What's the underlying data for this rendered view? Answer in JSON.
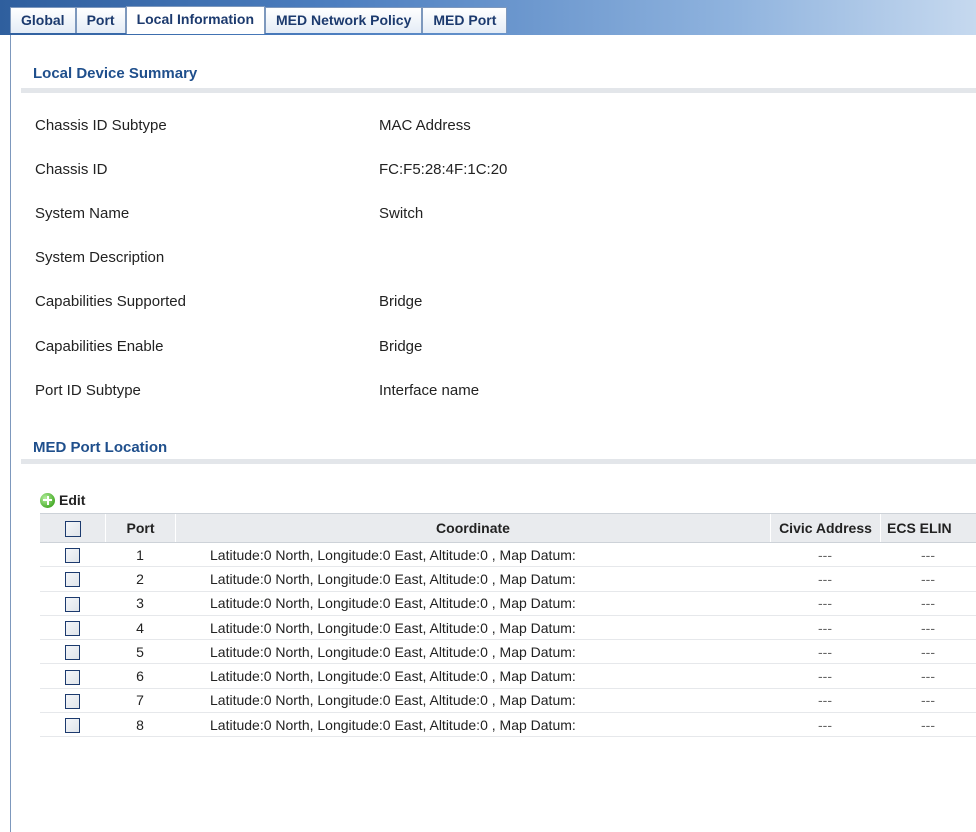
{
  "tabs": [
    {
      "label": "Global"
    },
    {
      "label": "Port"
    },
    {
      "label": "Local Information"
    },
    {
      "label": "MED Network Policy"
    },
    {
      "label": "MED Port"
    }
  ],
  "local_summary": {
    "title": "Local Device Summary",
    "rows": [
      {
        "label": "Chassis ID Subtype",
        "value": "MAC Address"
      },
      {
        "label": "Chassis ID",
        "value": "FC:F5:28:4F:1C:20"
      },
      {
        "label": "System Name",
        "value": "Switch"
      },
      {
        "label": "System Description",
        "value": ""
      },
      {
        "label": "Capabilities Supported",
        "value": "Bridge"
      },
      {
        "label": "Capabilities Enable",
        "value": "Bridge"
      },
      {
        "label": "Port ID Subtype",
        "value": "Interface name"
      }
    ]
  },
  "med_location": {
    "title": "MED Port Location",
    "edit_label": "Edit",
    "columns": [
      "Port",
      "Coordinate",
      "Civic Address",
      "ECS ELIN"
    ],
    "rows": [
      {
        "port": "1",
        "coordinate": "Latitude:0 North, Longitude:0 East, Altitude:0 , Map Datum:",
        "civic": "---",
        "ecs": "---"
      },
      {
        "port": "2",
        "coordinate": "Latitude:0 North, Longitude:0 East, Altitude:0 , Map Datum:",
        "civic": "---",
        "ecs": "---"
      },
      {
        "port": "3",
        "coordinate": "Latitude:0 North, Longitude:0 East, Altitude:0 , Map Datum:",
        "civic": "---",
        "ecs": "---"
      },
      {
        "port": "4",
        "coordinate": "Latitude:0 North, Longitude:0 East, Altitude:0 , Map Datum:",
        "civic": "---",
        "ecs": "---"
      },
      {
        "port": "5",
        "coordinate": "Latitude:0 North, Longitude:0 East, Altitude:0 , Map Datum:",
        "civic": "---",
        "ecs": "---"
      },
      {
        "port": "6",
        "coordinate": "Latitude:0 North, Longitude:0 East, Altitude:0 , Map Datum:",
        "civic": "---",
        "ecs": "---"
      },
      {
        "port": "7",
        "coordinate": "Latitude:0 North, Longitude:0 East, Altitude:0 , Map Datum:",
        "civic": "---",
        "ecs": "---"
      },
      {
        "port": "8",
        "coordinate": "Latitude:0 North, Longitude:0 East, Altitude:0 , Map Datum:",
        "civic": "---",
        "ecs": "---"
      }
    ]
  }
}
